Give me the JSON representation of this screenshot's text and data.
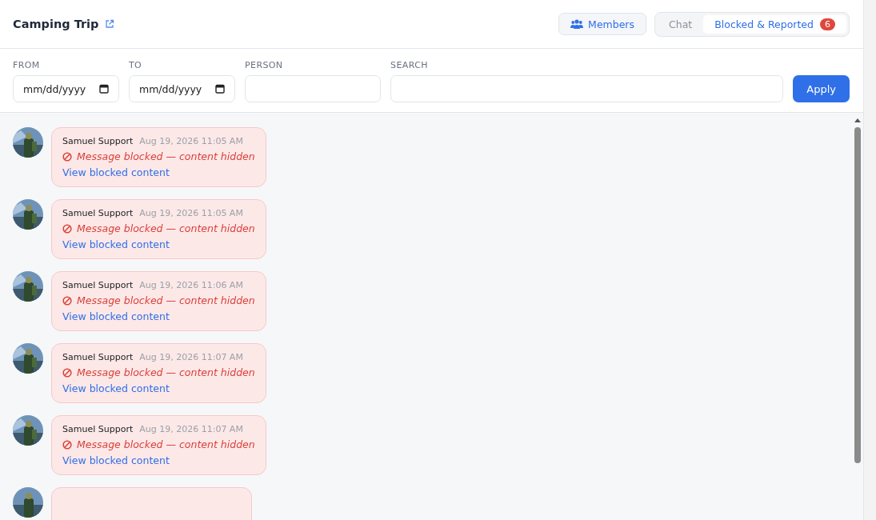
{
  "header": {
    "title": "Camping Trip",
    "members_button": "Members",
    "tabs": [
      {
        "label": "Chat",
        "selected": false
      },
      {
        "label": "Blocked & Reported",
        "selected": true,
        "badge": "6"
      }
    ]
  },
  "filters": {
    "fields": [
      {
        "label": "FROM",
        "kind": "date",
        "placeholder": "mm/dd/yyyy"
      },
      {
        "label": "TO",
        "kind": "date",
        "placeholder": "mm/dd/yyyy"
      },
      {
        "label": "PERSON",
        "kind": "text"
      },
      {
        "label": "SEARCH",
        "kind": "text"
      }
    ],
    "apply_button": "Apply"
  },
  "messages": [
    {
      "sender": "Samuel Support",
      "time": "Aug 19, 2026 11:05 AM",
      "notice": "Message blocked — content hidden",
      "link": "View blocked content"
    },
    {
      "sender": "Samuel Support",
      "time": "Aug 19, 2026 11:05 AM",
      "notice": "Message blocked — content hidden",
      "link": "View blocked content"
    },
    {
      "sender": "Samuel Support",
      "time": "Aug 19, 2026 11:06 AM",
      "notice": "Message blocked — content hidden",
      "link": "View blocked content"
    },
    {
      "sender": "Samuel Support",
      "time": "Aug 19, 2026 11:07 AM",
      "notice": "Message blocked — content hidden",
      "link": "View blocked content"
    },
    {
      "sender": "Samuel Support",
      "time": "Aug 19, 2026 11:07 AM",
      "notice": "Message blocked — content hidden",
      "link": "View blocked content"
    }
  ]
}
